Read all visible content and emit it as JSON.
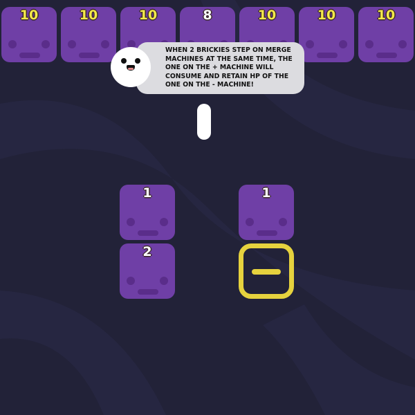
{
  "colors": {
    "background": "#222238",
    "brick": "#6f3fa6",
    "hp_text": "#f4e94a",
    "machine": "#e6d23e",
    "bubble": "#dcdce0"
  },
  "top_row": [
    {
      "hp": "10",
      "highlight": false
    },
    {
      "hp": "10",
      "highlight": false
    },
    {
      "hp": "10",
      "highlight": false
    },
    {
      "hp": "8",
      "highlight": true
    },
    {
      "hp": "10",
      "highlight": false
    },
    {
      "hp": "10",
      "highlight": false
    },
    {
      "hp": "10",
      "highlight": false
    }
  ],
  "tutorial": {
    "text": "When 2 brickies step on merge machines at the same time, the one on the + machine will consume and retain HP of the one on the - machine!",
    "speaker_icon": "smiling-face-icon"
  },
  "board": {
    "bricks": [
      {
        "hp": "1"
      },
      {
        "hp": "1"
      },
      {
        "hp": "2"
      }
    ],
    "machine": {
      "type": "minus",
      "icon": "minus-icon"
    }
  }
}
